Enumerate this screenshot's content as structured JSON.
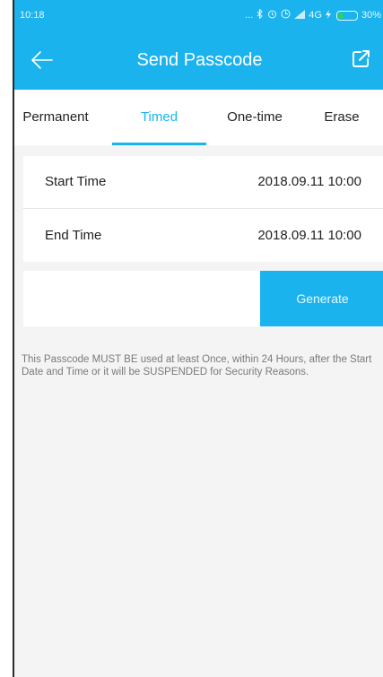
{
  "status_bar": {
    "time": "10:18",
    "dots": "...",
    "network": "4G",
    "battery": "30%",
    "battery_level": 0.3
  },
  "header": {
    "title": "Send Passcode",
    "back_icon": "arrow-left-icon",
    "share_icon": "share-icon",
    "color": "#1ab3ee"
  },
  "tabs": [
    {
      "label": "Permanent",
      "active": false
    },
    {
      "label": "Timed",
      "active": true
    },
    {
      "label": "One-time",
      "active": false
    },
    {
      "label": "Erase",
      "active": false
    }
  ],
  "times": {
    "start_label": "Start Time",
    "start_value": "2018.09.11 10:00",
    "end_label": "End Time",
    "end_value": "2018.09.11 10:00"
  },
  "actions": {
    "generate_label": "Generate"
  },
  "notice": "This Passcode MUST BE used at least Once, within 24 Hours, after the Start Date and Time or it will be SUSPENDED for Security Reasons."
}
